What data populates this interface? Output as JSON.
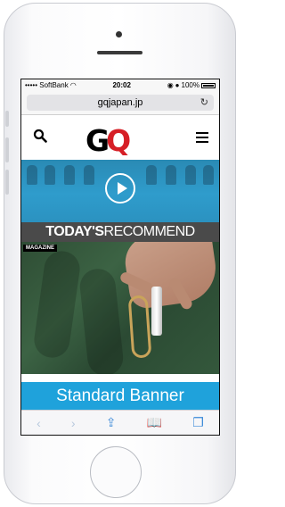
{
  "status_bar": {
    "carrier": "••••• SoftBank",
    "time": "20:02",
    "battery": "100%"
  },
  "browser": {
    "url": "gqjapan.jp"
  },
  "site": {
    "logo_g": "G",
    "logo_q": "Q",
    "section_title_bold": "TODAY'S",
    "section_title_light": "RECOMMEND",
    "article_tag": "MAGAZINE"
  },
  "ad": {
    "banner_label": "Standard Banner"
  },
  "toolbar": {
    "back_glyph": "‹",
    "forward_glyph": "›",
    "share_glyph": "⇪",
    "bookmarks_glyph": "📖",
    "tabs_glyph": "❐"
  },
  "colors": {
    "banner": "#1fa2db",
    "logo_q": "#d61f26",
    "toolbar_active": "#3c8ad8"
  }
}
